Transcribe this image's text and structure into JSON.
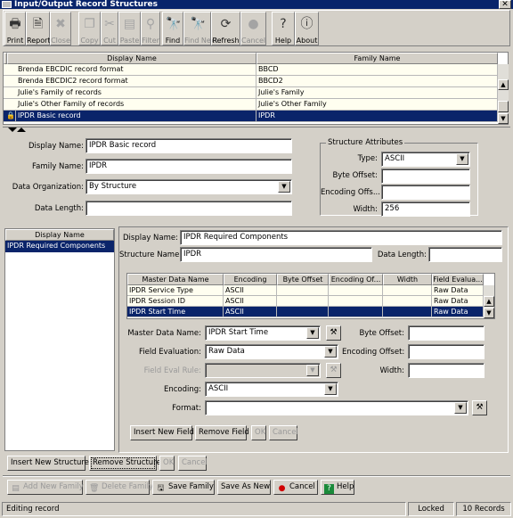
{
  "window": {
    "title": "Input/Output Record Structures",
    "close": "✕"
  },
  "toolbar": [
    {
      "label": "Print",
      "icon": "🖶",
      "enabled": true
    },
    {
      "label": "Report",
      "icon": "🗎",
      "enabled": true
    },
    {
      "label": "Close",
      "icon": "✖",
      "enabled": false
    },
    {
      "label": "Copy",
      "icon": "❐",
      "enabled": false
    },
    {
      "label": "Cut",
      "icon": "✂",
      "enabled": false
    },
    {
      "label": "Paste",
      "icon": "▤",
      "enabled": false
    },
    {
      "label": "Filter",
      "icon": "⚲",
      "enabled": false
    },
    {
      "label": "Find",
      "icon": "🔭",
      "enabled": true
    },
    {
      "label": "Find Next",
      "icon": "🔭",
      "enabled": false
    },
    {
      "label": "Refresh",
      "icon": "⟳",
      "enabled": true
    },
    {
      "label": "Cancel",
      "icon": "●",
      "enabled": false
    },
    {
      "label": "Help",
      "icon": "?",
      "enabled": true
    },
    {
      "label": "About",
      "icon": "ⓘ",
      "enabled": true
    }
  ],
  "records": {
    "columns": [
      "Display Name",
      "Family Name"
    ],
    "rows": [
      {
        "display": "Brenda EBCDIC record format",
        "family": "BBCD"
      },
      {
        "display": "Brenda EBCDIC2 record format",
        "family": "BBCD2"
      },
      {
        "display": "Julie's Family of records",
        "family": "Julie's Family"
      },
      {
        "display": "Julie's Other Family of records",
        "family": "Julie's Other Family"
      },
      {
        "display": "IPDR Basic record",
        "family": "IPDR"
      }
    ]
  },
  "record_form": {
    "display_name_label": "Display Name:",
    "display_name": "IPDR Basic record",
    "family_name_label": "Family Name:",
    "family_name": "IPDR",
    "data_org_label": "Data Organization:",
    "data_org": "By Structure",
    "data_length_label": "Data Length:",
    "data_length": ""
  },
  "structure_attributes": {
    "title": "Structure Attributes",
    "type_label": "Type:",
    "type": "ASCII",
    "byte_offset_label": "Byte Offset:",
    "byte_offset": "",
    "encoding_offset_label": "Encoding Offs...",
    "encoding_offset": "",
    "width_label": "Width:",
    "width": "256"
  },
  "structures_list": {
    "header": "Display Name",
    "items": [
      "IPDR Required Components"
    ]
  },
  "structure_form": {
    "display_name_label": "Display Name:",
    "display_name": "IPDR Required Components",
    "structure_name_label": "Structure Name:",
    "structure_name": "IPDR",
    "data_length_label": "Data Length:",
    "data_length": ""
  },
  "fields": {
    "columns": [
      "Master Data Name",
      "Encoding",
      "Byte Offset",
      "Encoding Of...",
      "Width",
      "Field Evalua..."
    ],
    "rows": [
      [
        "IPDR Service Type",
        "ASCII",
        "",
        "",
        "",
        "Raw Data"
      ],
      [
        "IPDR Session ID",
        "ASCII",
        "",
        "",
        "",
        "Raw Data"
      ],
      [
        "IPDR Start Time",
        "ASCII",
        "",
        "",
        "",
        "Raw Data"
      ]
    ]
  },
  "field_form": {
    "master_label": "Master Data Name:",
    "master": "IPDR Start Time",
    "byte_offset_label": "Byte Offset:",
    "byte_offset": "",
    "field_eval_label": "Field Evaluation:",
    "field_eval": "Raw Data",
    "encoding_offset_label": "Encoding Offset:",
    "encoding_offset": "",
    "field_eval_rule_label": "Field Eval Rule:",
    "field_eval_rule": "",
    "width_label": "Width:",
    "width": "",
    "encoding_label": "Encoding:",
    "encoding": "ASCII",
    "format_label": "Format:",
    "format": ""
  },
  "field_buttons": {
    "insert": "Insert New Field",
    "remove": "Remove Field",
    "ok": "OK",
    "cancel": "Cancel"
  },
  "structure_buttons": {
    "insert": "Insert New Structure",
    "remove": "Remove Structure",
    "ok": "OK",
    "cancel": "Cancel"
  },
  "family_buttons": {
    "add": "Add New Family",
    "delete": "Delete Family",
    "save": "Save Family",
    "save_as": "Save As New",
    "cancel": "Cancel",
    "help": "Help"
  },
  "status": {
    "message": "Editing record",
    "lock": "Locked",
    "count": "10 Records"
  }
}
